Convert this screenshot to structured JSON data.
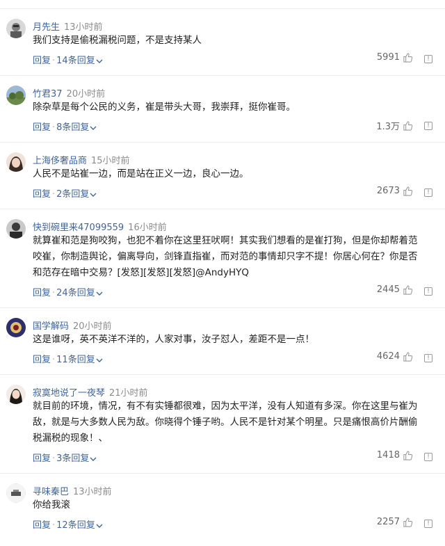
{
  "ui": {
    "reply_label": "回复",
    "separator": "·",
    "icons": {
      "like": "thumbs-up-icon",
      "report": "report-icon",
      "expand": "chevron-down-icon"
    },
    "colors": {
      "name": "#406599",
      "time": "#8c8c8c",
      "count": "#666666",
      "divider": "#ececec"
    }
  },
  "comments": [
    {
      "user": "月先生",
      "time": "13小时前",
      "text": "我们支持是偷税漏税问题，不是支持某人",
      "replies": "14条回复",
      "likes": "5991"
    },
    {
      "user": "竹君37",
      "time": "20小时前",
      "text": "除杂草是每个公民的义务，崔是带头大哥，我崇拜，挺你崔哥。",
      "replies": "8条回复",
      "likes": "1.3万"
    },
    {
      "user": "上海侈奢品商",
      "time": "15小时前",
      "text": "人民不是站崔一边，而是站在正义一边，良心一边。",
      "replies": "2条回复",
      "likes": "2673"
    },
    {
      "user": "快到碗里来47099559",
      "time": "16小时前",
      "text": "就算崔和范是狗咬狗，也犯不着你在这里狂吠啊！其实我们想看的是崔打狗，但是你却帮着范咬崔，你制造舆论，偏离导向，剑锋直指崔，而对范的事情却只字不提！你居心何在？你是否和范存在暗中交易？[发怒][发怒][发怒]@AndyHYQ",
      "replies": "24条回复",
      "likes": "2445"
    },
    {
      "user": "国学解码",
      "time": "20小时前",
      "text": "这是谁呀，英不英洋不洋的，人家对事，汝子怼人，差距不是一点！",
      "replies": "11条回复",
      "likes": "4624"
    },
    {
      "user": "寂寞地说了一夜琴",
      "time": "21小时前",
      "text": "就目前的环境，情况，有不有实锤都很难，因为太平洋，没有人知道有多深。你在这里与崔为敌，就是与大多数人民为敌。你晓得个锤子哟。人民不是针对某个明星。只是痛恨高价片酬偷税漏税的现象！、",
      "replies": "3条回复",
      "likes": "1418"
    },
    {
      "user": "寻味秦巴",
      "time": "13小时前",
      "text": "你给我滚",
      "replies": "12条回复",
      "likes": "2257"
    }
  ]
}
